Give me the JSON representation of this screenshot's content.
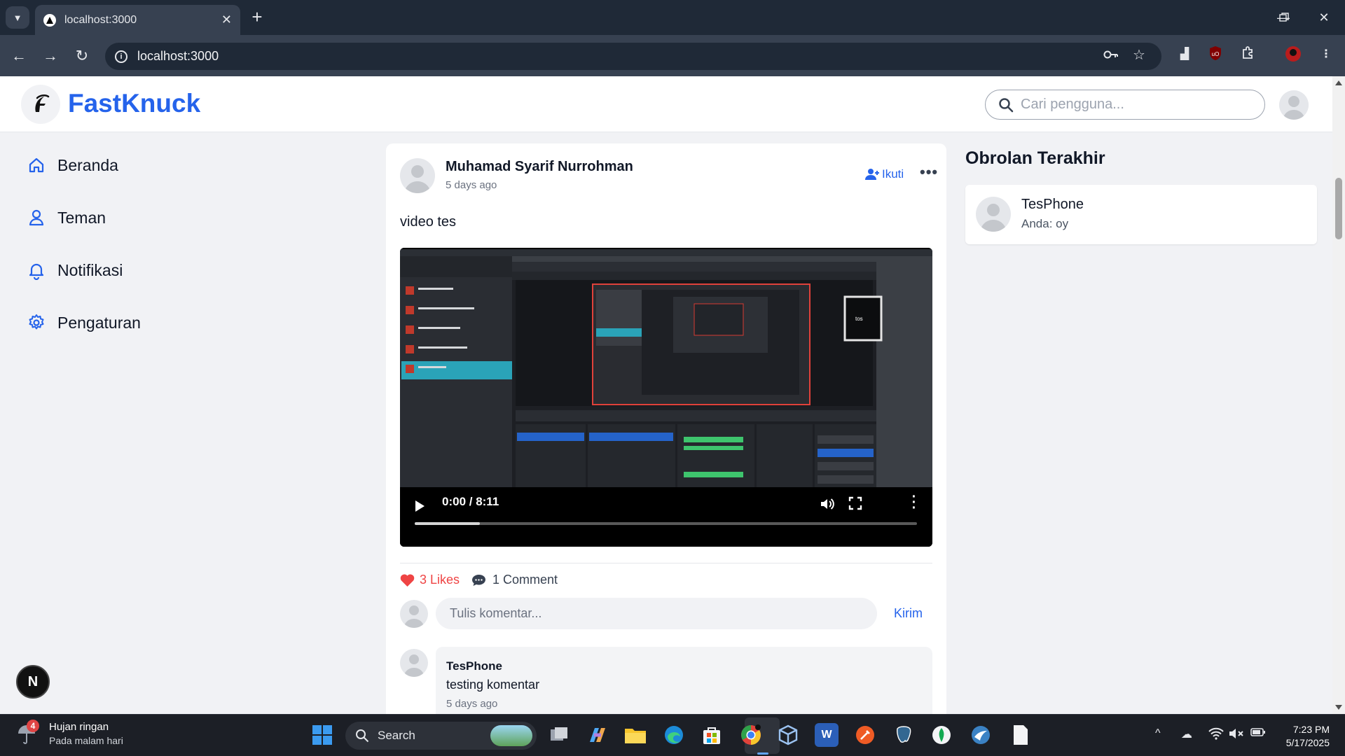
{
  "browser": {
    "tab_title": "localhost:3000",
    "tab_close": "✕",
    "new_tab": "+",
    "url": "localhost:3000"
  },
  "site": {
    "brand": "FastKnuck",
    "logo_letter": "F",
    "search_placeholder": "Cari pengguna..."
  },
  "sidebar": {
    "items": [
      {
        "label": "Beranda",
        "icon": "home-icon"
      },
      {
        "label": "Teman",
        "icon": "user-icon"
      },
      {
        "label": "Notifikasi",
        "icon": "bell-icon"
      },
      {
        "label": "Pengaturan",
        "icon": "gear-icon"
      }
    ]
  },
  "post": {
    "author": "Muhamad Syarif Nurrohman",
    "time": "5 days ago",
    "follow_label": "Ikuti",
    "more_label": "•••",
    "text": "video tes",
    "video": {
      "current_time": "0:00",
      "duration": "8:11",
      "time_display": "0:00 / 8:11",
      "buffered_fraction": 0.13
    },
    "likes_label": "3 Likes",
    "comments_label": "1 Comment",
    "comment_placeholder": "Tulis komentar...",
    "send_label": "Kirim",
    "comments": [
      {
        "author": "TesPhone",
        "text": "testing komentar",
        "time": "5 days ago"
      }
    ]
  },
  "chat": {
    "title": "Obrolan Terakhir",
    "items": [
      {
        "name": "TesPhone",
        "last_message": "Anda: oy"
      }
    ]
  },
  "dev_badge": "N",
  "taskbar": {
    "weather_badge": "4",
    "weather_title": "Hujan ringan",
    "weather_subtitle": "Pada malam hari",
    "search_label": "Search",
    "time": "7:23 PM",
    "date": "5/17/2025"
  },
  "colors": {
    "brand": "#2563eb",
    "like": "#ef4444",
    "page_bg": "#f1f2f5",
    "chrome_dark": "#1f2937"
  }
}
